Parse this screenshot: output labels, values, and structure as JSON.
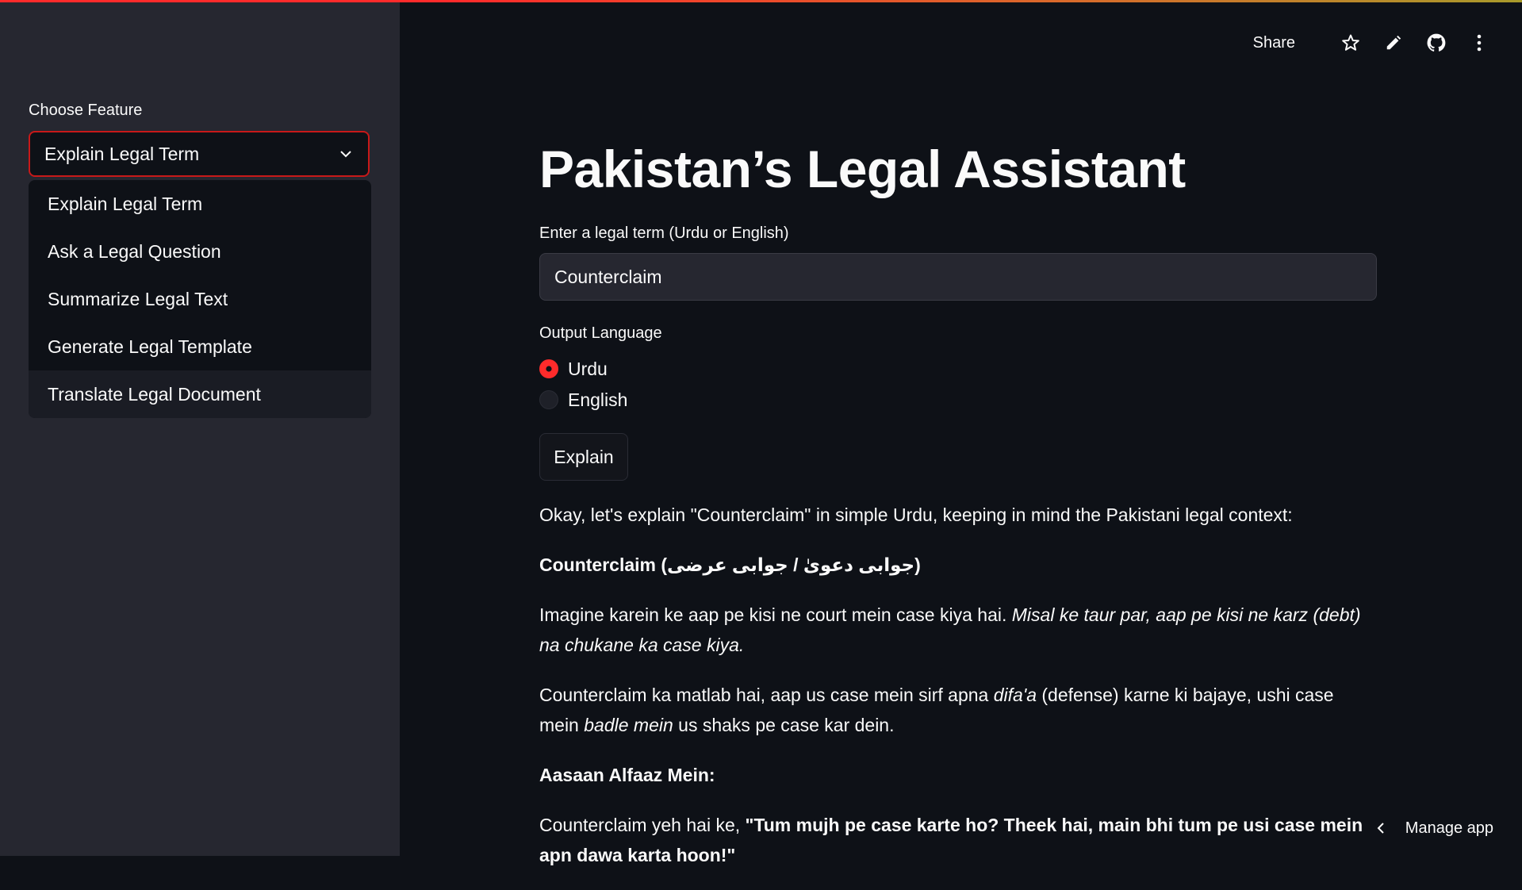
{
  "sidebar": {
    "select_label": "Choose Feature",
    "selected": "Explain Legal Term",
    "options": [
      "Explain Legal Term",
      "Ask a Legal Question",
      "Summarize Legal Text",
      "Generate Legal Template",
      "Translate Legal Document"
    ]
  },
  "header": {
    "share": "Share",
    "icons": [
      "star-icon",
      "pencil-icon",
      "github-icon",
      "more-vertical-icon"
    ]
  },
  "main": {
    "title": "Pakistan’s Legal Assistant",
    "input_label": "Enter a legal term (Urdu or English)",
    "input_value": "Counterclaim",
    "language_label": "Output Language",
    "languages": [
      "Urdu",
      "English"
    ],
    "selected_language": "Urdu",
    "button_label": "Explain"
  },
  "response": {
    "intro": "Okay, let's explain \"Counterclaim\" in simple Urdu, keeping in mind the Pakistani legal context:",
    "heading": "Counterclaim (جوابی دعویٰ / جوابی عرضی)",
    "p1_plain": "Imagine karein ke aap pe kisi ne court mein case kiya hai. ",
    "p1_italic": "Misal ke taur par, aap pe kisi ne karz (debt) na chukane ka case kiya.",
    "p2_a": "Counterclaim ka matlab hai, aap us case mein sirf apna ",
    "p2_b": "difa'a",
    "p2_c": " (defense) karne ki bajaye, ushi case mein ",
    "p2_d": "badle mein",
    "p2_e": " us shaks pe case kar dein.",
    "subheading": "Aasaan Alfaaz Mein:",
    "p3_plain": "Counterclaim yeh hai ke, ",
    "p3_bold": "\"Tum mujh pe case karte ho? Theek hai, main bhi tum pe usi case mein apn dawa karta hoon!\""
  },
  "footer": {
    "manage_app": "Manage app"
  },
  "colors": {
    "accent": "#ff2b2b",
    "background": "#0e1117",
    "sidebar": "#262730"
  }
}
